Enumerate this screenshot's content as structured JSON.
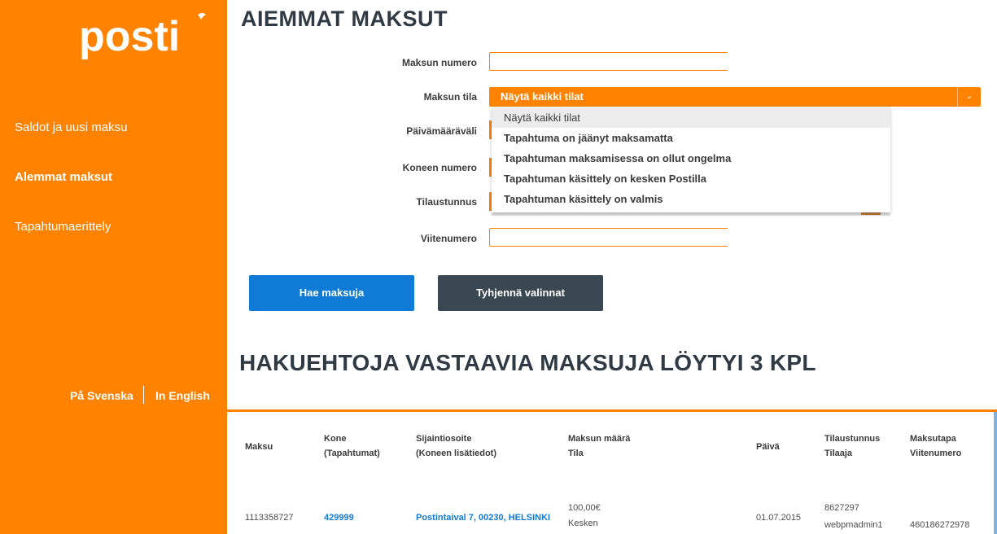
{
  "sidebar": {
    "logo_text": "posti",
    "nav": [
      {
        "label": "Saldot ja uusi maksu"
      },
      {
        "label": "Alemmat maksut"
      },
      {
        "label": "Tapahtumaerittely"
      }
    ],
    "lang": {
      "swedish": "På Svenska",
      "english": "In English"
    }
  },
  "page": {
    "title": "AIEMMAT MAKSUT"
  },
  "form": {
    "labels": {
      "payment_number": "Maksun numero",
      "status": "Maksun tila",
      "date_range": "Päivämääräväli",
      "machine_number": "Koneen numero",
      "order_id": "Tilaustunnus",
      "reference": "Viitenumero"
    },
    "payment_number_value": "",
    "reference_value": "",
    "status_selected": "Näytä kaikki tilat",
    "status_options": [
      "Näytä kaikki tilat",
      "Tapahtuma on jäänyt maksamatta",
      "Tapahtuman maksamisessa on ollut ongelma",
      "Tapahtuman käsittely on kesken Postilla",
      "Tapahtuman käsittely on valmis"
    ],
    "search_button": "Hae maksuja",
    "clear_button": "Tyhjennä valinnat"
  },
  "results": {
    "title": "HAKUEHTOJA VASTAAVIA MAKSUJA LÖYTYI 3 KPL",
    "headers": {
      "payment": "Maksu",
      "machine_1": "Kone",
      "machine_2": "(Tapahtumat)",
      "location_1": "Sijaintiosoite",
      "location_2": "(Koneen lisätiedot)",
      "amount_1": "Maksun määrä",
      "amount_2": "Tila",
      "date": "Päivä",
      "order_1": "Tilaustunnus",
      "order_2": "Tilaaja",
      "method_1": "Maksutapa",
      "method_2": "Viitenumero"
    },
    "rows": [
      {
        "payment": "1113358727",
        "machine": "429999",
        "location": "Postintaival 7, 00230, HELSINKI",
        "amount": "100,00€",
        "status": "Kesken",
        "date": "01.07.2015",
        "order_id": "8627297",
        "orderer": "webpmadmin1",
        "reference": "460186272978"
      }
    ]
  },
  "colors": {
    "brand_orange": "#ff8200",
    "primary_blue": "#0f7bd6",
    "dark_slate": "#3a4852"
  }
}
